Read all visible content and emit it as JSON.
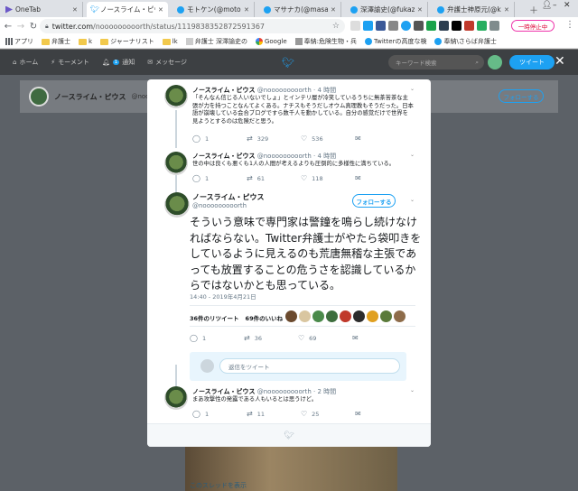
{
  "browser": {
    "tabs": [
      {
        "title": "OneTab",
        "icon": "onetab-icon",
        "color": "#6b57c7"
      },
      {
        "title": "ノースライム・ピウス",
        "icon": "twitter-icon",
        "color": "#1da1f2",
        "active": true
      },
      {
        "title": "モトケン(@motoken",
        "icon": "twitter-icon",
        "color": "#1da1f2"
      },
      {
        "title": "マサナカ(@masan",
        "icon": "twitter-icon",
        "color": "#1da1f2"
      },
      {
        "title": "深澤諭史(@fukaz",
        "icon": "twitter-icon",
        "color": "#1da1f2"
      },
      {
        "title": "弁護士神原元(@k",
        "icon": "twitter-icon",
        "color": "#1da1f2"
      }
    ],
    "url_host": "twitter.com",
    "url_path": "/nooooooooorth/status/1119838352872591367",
    "pause_label": "一時停止中",
    "bookmarks": [
      {
        "label": "アプリ",
        "icon": "apps-grid-icon"
      },
      {
        "label": "弁護士",
        "icon": "folder-icon"
      },
      {
        "label": "k",
        "icon": "folder-icon"
      },
      {
        "label": "ジャーナリスト",
        "icon": "folder-icon"
      },
      {
        "label": "lk",
        "icon": "folder-icon"
      },
      {
        "label": "弁護士 深澤諭史の",
        "icon": "page-icon"
      },
      {
        "label": "Google",
        "icon": "google-icon"
      },
      {
        "label": "奉納:危険生物・兵",
        "icon": "page-icon"
      },
      {
        "label": "Twitterの高度な検",
        "icon": "twitter-icon"
      },
      {
        "label": "奉納\\さらば弁護士",
        "icon": "twitter-icon"
      }
    ]
  },
  "twitter_nav": {
    "home": "ホーム",
    "moments": "モーメント",
    "notifications": "通知",
    "messages": "メッセージ",
    "search_placeholder": "キーワード検索",
    "tweet_button": "ツイート",
    "notif_badge": "1"
  },
  "profile_bar": {
    "name": "ノースライム・ピウス",
    "handle": "@nooooooooorth",
    "follow": "フォローする"
  },
  "background_link": "このスレッドを表示",
  "thread": [
    {
      "name": "ノースライム・ピウス",
      "handle": "@nooooooooorth",
      "time": "· 4 時間",
      "text": "「そんなん信じる人いないでしょ」とインテリ層が冷笑しているうちに無茶苦茶な主張が力を持つことなんてよくある。ナチスもそうだしオウム真理教もそうだった。日本語が崩壊している会合ブログですら数千人を動かしている。自分の感覚だけで世界を見ようとするのは危険だと思う。",
      "replies": "1",
      "retweets": "329",
      "likes": "536"
    },
    {
      "name": "ノースライム・ピウス",
      "handle": "@nooooooooorth",
      "time": "· 4 時間",
      "text": "世の中は良くも悪くも1人の人間が考えるよりも圧倒的に多様性に満ちている。",
      "replies": "1",
      "retweets": "61",
      "likes": "118"
    }
  ],
  "main_tweet": {
    "name": "ノースライム・ピウス",
    "handle": "@nooooooooorth",
    "follow": "フォローする",
    "text": "そういう意味で専門家は警鐘を鳴らし続けなければならない。Twitter弁護士がやたら袋叩きをしているように見えるのも荒唐無稽な主張であっても放置することの危うさを認識しているからではないかとも思っている。",
    "timestamp": "14:40 - 2019年4月21日",
    "retweet_count": "36件のリツイート",
    "like_count": "69件のいいね",
    "replies": "1",
    "retweets": "36",
    "likes": "69",
    "reply_placeholder": "返信をツイート"
  },
  "reply_tweet": {
    "name": "ノースライム・ピウス",
    "handle": "@nooooooooorth",
    "time": "· 2 時間",
    "text": "まあ攻撃性の発露である人もいるとは思うけど。",
    "replies": "1",
    "retweets": "11",
    "likes": "25"
  },
  "colors": {
    "twitter_blue": "#1da1f2",
    "text_gray": "#657786",
    "reply_box": "#e8f5fd"
  }
}
